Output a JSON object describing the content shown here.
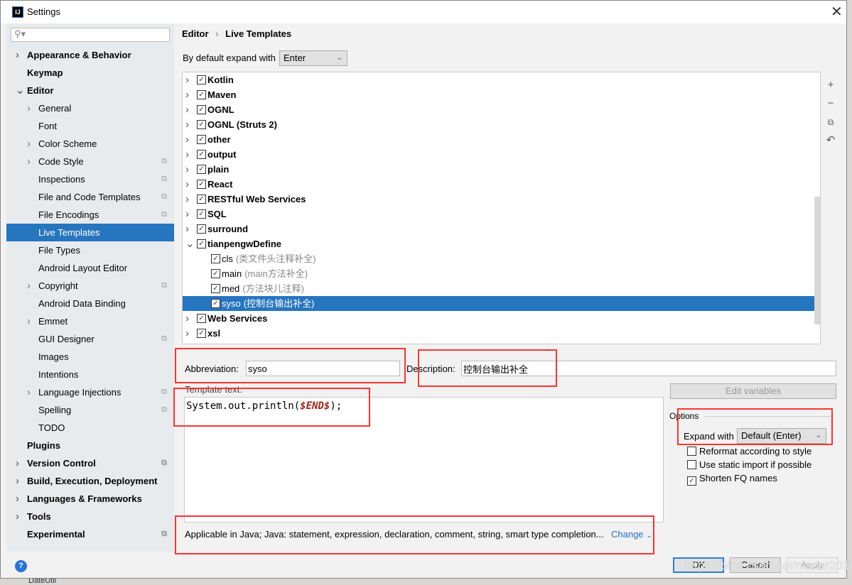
{
  "window": {
    "title": "Settings",
    "logo": "IJ",
    "close_icon": "close-icon"
  },
  "search": {
    "placeholder": ""
  },
  "sidebar": {
    "items": [
      {
        "label": "Appearance & Behavior",
        "bold": true,
        "arrow": "right",
        "indent": 0
      },
      {
        "label": "Keymap",
        "bold": true,
        "arrow": "",
        "indent": 0
      },
      {
        "label": "Editor",
        "bold": true,
        "arrow": "down",
        "indent": 0
      },
      {
        "label": "General",
        "arrow": "right",
        "indent": 1
      },
      {
        "label": "Font",
        "arrow": "",
        "indent": 1
      },
      {
        "label": "Color Scheme",
        "arrow": "right",
        "indent": 1
      },
      {
        "label": "Code Style",
        "arrow": "right",
        "indent": 1,
        "copy": true
      },
      {
        "label": "Inspections",
        "arrow": "",
        "indent": 1,
        "copy": true
      },
      {
        "label": "File and Code Templates",
        "arrow": "",
        "indent": 1,
        "copy": true
      },
      {
        "label": "File Encodings",
        "arrow": "",
        "indent": 1,
        "copy": true
      },
      {
        "label": "Live Templates",
        "arrow": "",
        "indent": 1,
        "selected": true
      },
      {
        "label": "File Types",
        "arrow": "",
        "indent": 1
      },
      {
        "label": "Android Layout Editor",
        "arrow": "",
        "indent": 1
      },
      {
        "label": "Copyright",
        "arrow": "right",
        "indent": 1,
        "copy": true
      },
      {
        "label": "Android Data Binding",
        "arrow": "",
        "indent": 1
      },
      {
        "label": "Emmet",
        "arrow": "right",
        "indent": 1
      },
      {
        "label": "GUI Designer",
        "arrow": "",
        "indent": 1,
        "copy": true
      },
      {
        "label": "Images",
        "arrow": "",
        "indent": 1
      },
      {
        "label": "Intentions",
        "arrow": "",
        "indent": 1
      },
      {
        "label": "Language Injections",
        "arrow": "right",
        "indent": 1,
        "copy": true
      },
      {
        "label": "Spelling",
        "arrow": "",
        "indent": 1,
        "copy": true
      },
      {
        "label": "TODO",
        "arrow": "",
        "indent": 1
      },
      {
        "label": "Plugins",
        "bold": true,
        "arrow": "",
        "indent": 0
      },
      {
        "label": "Version Control",
        "bold": true,
        "arrow": "right",
        "indent": 0,
        "copy": true
      },
      {
        "label": "Build, Execution, Deployment",
        "bold": true,
        "arrow": "right",
        "indent": 0
      },
      {
        "label": "Languages & Frameworks",
        "bold": true,
        "arrow": "right",
        "indent": 0
      },
      {
        "label": "Tools",
        "bold": true,
        "arrow": "right",
        "indent": 0
      },
      {
        "label": "Experimental",
        "bold": true,
        "arrow": "",
        "indent": 0,
        "copy": true
      }
    ]
  },
  "breadcrumb": {
    "parent": "Editor",
    "sep": "›",
    "current": "Live Templates"
  },
  "expand_default": {
    "label": "By default expand with",
    "value": "Enter"
  },
  "tree": [
    {
      "name": "Kotlin",
      "group": true
    },
    {
      "name": "Maven",
      "group": true
    },
    {
      "name": "OGNL",
      "group": true
    },
    {
      "name": "OGNL (Struts 2)",
      "group": true
    },
    {
      "name": "other",
      "group": true
    },
    {
      "name": "output",
      "group": true
    },
    {
      "name": "plain",
      "group": true
    },
    {
      "name": "React",
      "group": true
    },
    {
      "name": "RESTful Web Services",
      "group": true
    },
    {
      "name": "SQL",
      "group": true
    },
    {
      "name": "surround",
      "group": true
    },
    {
      "name": "tianpengwDefine",
      "group": true,
      "expanded": true
    },
    {
      "name": "cls",
      "desc": "(类文件头注释补全)"
    },
    {
      "name": "main",
      "desc": "(main方法补全)"
    },
    {
      "name": "med",
      "desc": "(方法块儿注释)"
    },
    {
      "name": "syso",
      "desc": "(控制台输出补全)",
      "selected": true
    },
    {
      "name": "Web Services",
      "group": true
    },
    {
      "name": "xsl",
      "group": true
    }
  ],
  "toolbar": {
    "icons": [
      "plus-icon",
      "minus-icon",
      "copy-icon",
      "undo-icon"
    ]
  },
  "abbreviation": {
    "label": "Abbreviation:",
    "value": "syso"
  },
  "description": {
    "label": "Description:",
    "value": "控制台输出补全"
  },
  "template_text": {
    "label": "Template text:",
    "code_prefix": "System.out.println(",
    "code_var": "$END$",
    "code_suffix": ");"
  },
  "edit_variables": "Edit variables",
  "options": {
    "title": "Options",
    "expand_label": "Expand with",
    "expand_value": "Default (Enter)",
    "checks": [
      {
        "label": "Reformat according to style",
        "checked": false
      },
      {
        "label": "Use static import if possible",
        "checked": false
      },
      {
        "label": "Shorten FQ names",
        "checked": true
      }
    ]
  },
  "applicable": {
    "text": "Applicable in Java; Java: statement, expression, declaration, comment, string, smart type completion...",
    "change": "Change"
  },
  "buttons": {
    "ok": "OK",
    "cancel": "Cancel",
    "apply": "Apply"
  },
  "watermark": "https://blog.csdn.net/niader2010",
  "background_text": "DateUtil",
  "colors": {
    "selection": "#2675bf",
    "annotation": "#ff3333",
    "link": "#2470c7"
  }
}
